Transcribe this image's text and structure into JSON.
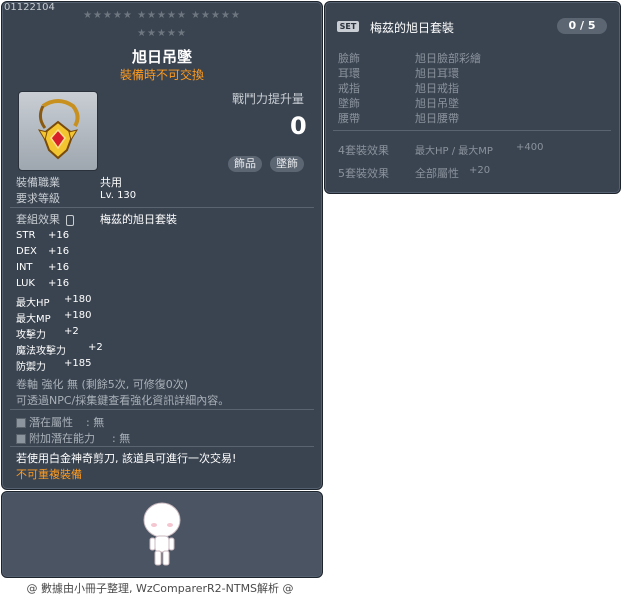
{
  "item": {
    "id": "01122104",
    "stars_row1": "★★★★★  ★★★★★  ★★★★★",
    "stars_row2": "★★★★★",
    "name": "旭日吊墜",
    "trade_note": "裝備時不可交換",
    "power_label": "戰鬥力提升量",
    "power_value": "0",
    "categories": [
      "飾品",
      "墜飾"
    ],
    "job_label": "裝備職業",
    "job_value": "共用",
    "level_label": "要求等級",
    "level_value": "Lv. 130",
    "set_label": "套組效果",
    "set_value": "梅茲的旭日套裝",
    "stats": [
      {
        "name": "STR",
        "value": "+16"
      },
      {
        "name": "DEX",
        "value": "+16"
      },
      {
        "name": "INT",
        "value": "+16"
      },
      {
        "name": "LUK",
        "value": "+16"
      },
      {
        "name": "最大HP",
        "value": "+180"
      },
      {
        "name": "最大MP",
        "value": "+180"
      },
      {
        "name": "攻擊力",
        "value": "+2"
      },
      {
        "name": "魔法攻擊力",
        "value": "+2"
      },
      {
        "name": "防禦力",
        "value": "+185"
      }
    ],
    "scroll_line": "卷軸 強化 無 (剩餘5次, 可修復0次)",
    "npc_line": "可透過NPC/採集鍵查看強化資訊詳細內容。",
    "potential_label": "潛在屬性",
    "potential_value": ": 無",
    "bonus_potential_label": "附加潛在能力",
    "bonus_potential_value": ": 無",
    "scissors_note": "若使用白金神奇剪刀, 該道具可進行一次交易!",
    "unique_equip": "不可重複裝備"
  },
  "set_panel": {
    "badge": "SET",
    "name": "梅茲的旭日套裝",
    "count": "0 / 5",
    "pieces": [
      {
        "slot": "臉飾",
        "item": "旭日臉部彩繪"
      },
      {
        "slot": "耳環",
        "item": "旭日耳環"
      },
      {
        "slot": "戒指",
        "item": "旭日戒指"
      },
      {
        "slot": "墜飾",
        "item": "旭日吊墜"
      },
      {
        "slot": "腰帶",
        "item": "旭日腰帶"
      }
    ],
    "effects": [
      {
        "label": "4套裝效果",
        "stat": "最大HP / 最大MP",
        "value": "+400"
      },
      {
        "label": "5套裝效果",
        "stat": "全部屬性",
        "value": "+20"
      }
    ]
  },
  "footer": "@ 數據由小冊子整理, WzComparerR2-NTMS解析 @",
  "colors": {
    "panel": "#3a4451",
    "accent_orange": "#ff9b1e",
    "muted": "#8a929c"
  }
}
